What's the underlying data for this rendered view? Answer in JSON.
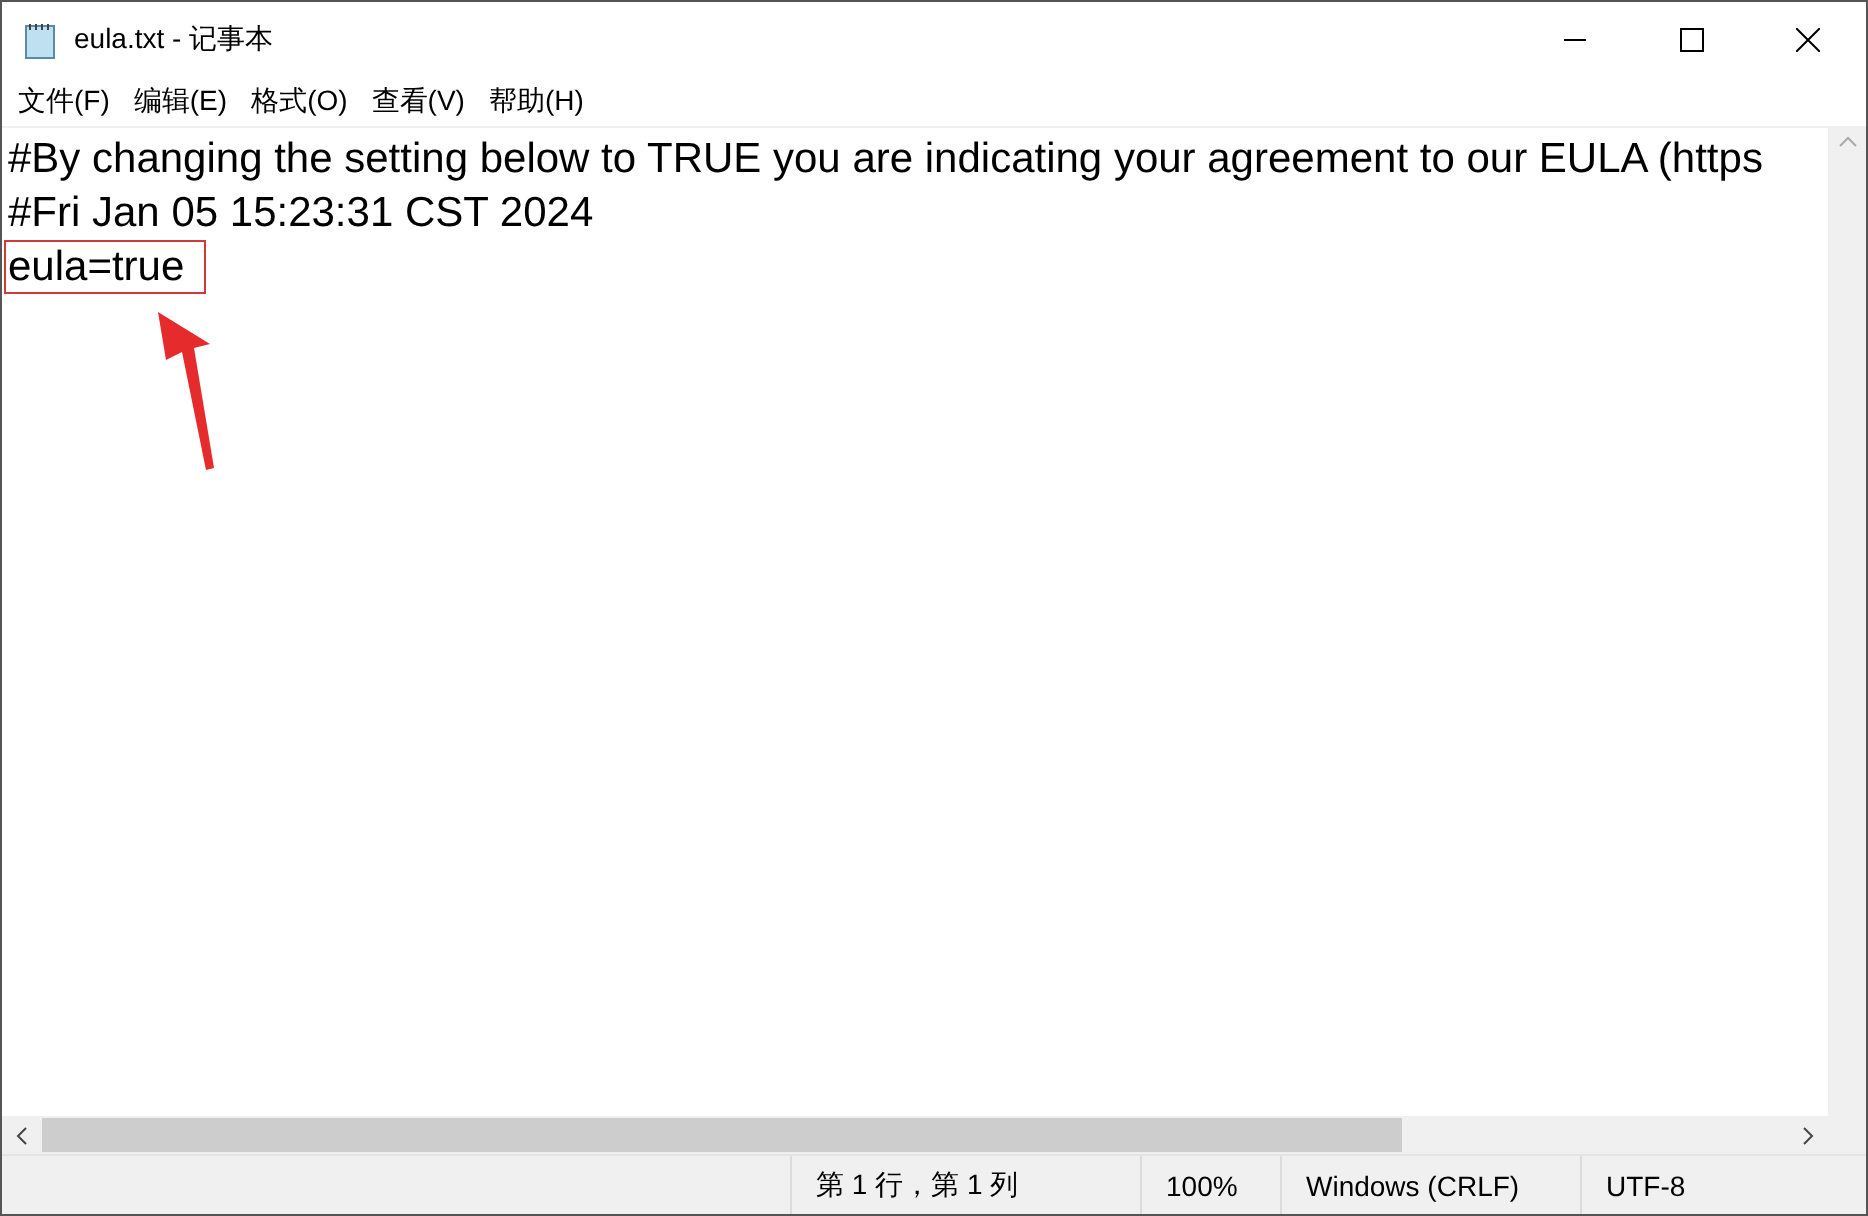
{
  "window": {
    "title": "eula.txt - 记事本"
  },
  "menu": [
    "文件(F)",
    "编辑(E)",
    "格式(O)",
    "查看(V)",
    "帮助(H)"
  ],
  "lines": [
    {
      "text": "#By changing the setting below to TRUE you are indicating your agreement to our EULA (https",
      "highlighted": false
    },
    {
      "text": "#Fri Jan 05 15:23:31 CST 2024",
      "highlighted": false
    },
    {
      "text": "eula=true",
      "highlighted": true
    }
  ],
  "status_bar": [
    "第 1 行，第 1 列",
    "100%",
    "Windows (CRLF)",
    "UTF-8"
  ]
}
